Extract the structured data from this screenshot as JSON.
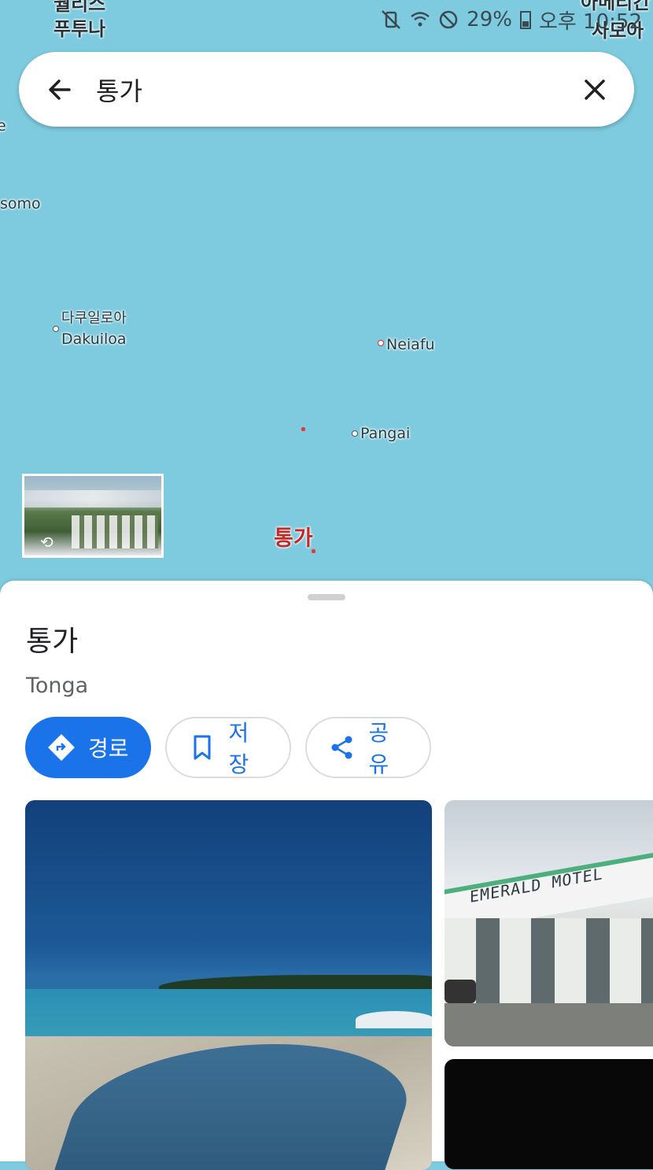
{
  "status_bar": {
    "battery": "29%",
    "time": "오후 10:52"
  },
  "map": {
    "labels": {
      "wallis_futuna_1": "월리스",
      "wallis_futuna_2": "푸투나",
      "american_samoa_1": "아메리칸",
      "american_samoa_2": "사모아",
      "somo": "somo",
      "e_fragment": "e",
      "dakuiloa_ko": "다쿠일로아",
      "dakuiloa_en": "Dakuiloa",
      "neiafu": "Neiafu",
      "pangai": "Pangai",
      "tonga": "통가"
    }
  },
  "search": {
    "query": "통가"
  },
  "place": {
    "title": "통가",
    "subtitle": "Tonga",
    "actions": {
      "directions": "경로",
      "save": "저장",
      "share": "공유"
    },
    "photo_sign": "EMERALD MOTEL"
  },
  "colors": {
    "accent": "#1a73e8",
    "map_water": "#7ecbdf",
    "place_label": "#c62828"
  }
}
